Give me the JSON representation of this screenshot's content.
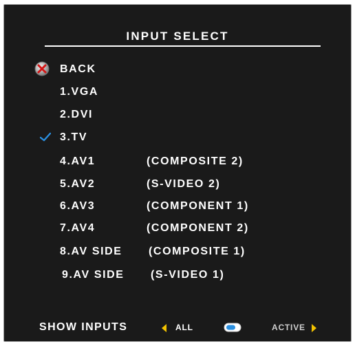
{
  "screen": {
    "title": "INPUT SELECT"
  },
  "menu": {
    "back_label": "BACK",
    "items": [
      {
        "label": "1.VGA",
        "detail": ""
      },
      {
        "label": "2.DVI",
        "detail": ""
      },
      {
        "label": "3.TV",
        "detail": "",
        "selected": true
      },
      {
        "label": "4.AV1",
        "detail": "(COMPOSITE 2)"
      },
      {
        "label": "5.AV2",
        "detail": "(S-VIDEO 2)"
      },
      {
        "label": "6.AV3",
        "detail": "(COMPONENT 1)"
      },
      {
        "label": "7.AV4",
        "detail": "(COMPONENT 2)"
      },
      {
        "label": "8.AV SIDE",
        "detail": "(COMPOSITE 1)"
      },
      {
        "label": "9.AV SIDE",
        "detail": "(S-VIDEO 1)"
      }
    ]
  },
  "footer": {
    "label": "SHOW INPUTS",
    "option_all": "ALL",
    "option_active": "ACTIVE"
  },
  "icons": {
    "back": "back-x-icon",
    "selected": "checkmark-icon",
    "toggle": "toggle-switch-icon",
    "left_arrow": "arrow-left-icon",
    "right_arrow": "arrow-right-icon"
  },
  "colors": {
    "background": "#1a1a1a",
    "text": "#ffffff",
    "check": "#2a8fe0",
    "arrow": "#f2c200"
  }
}
